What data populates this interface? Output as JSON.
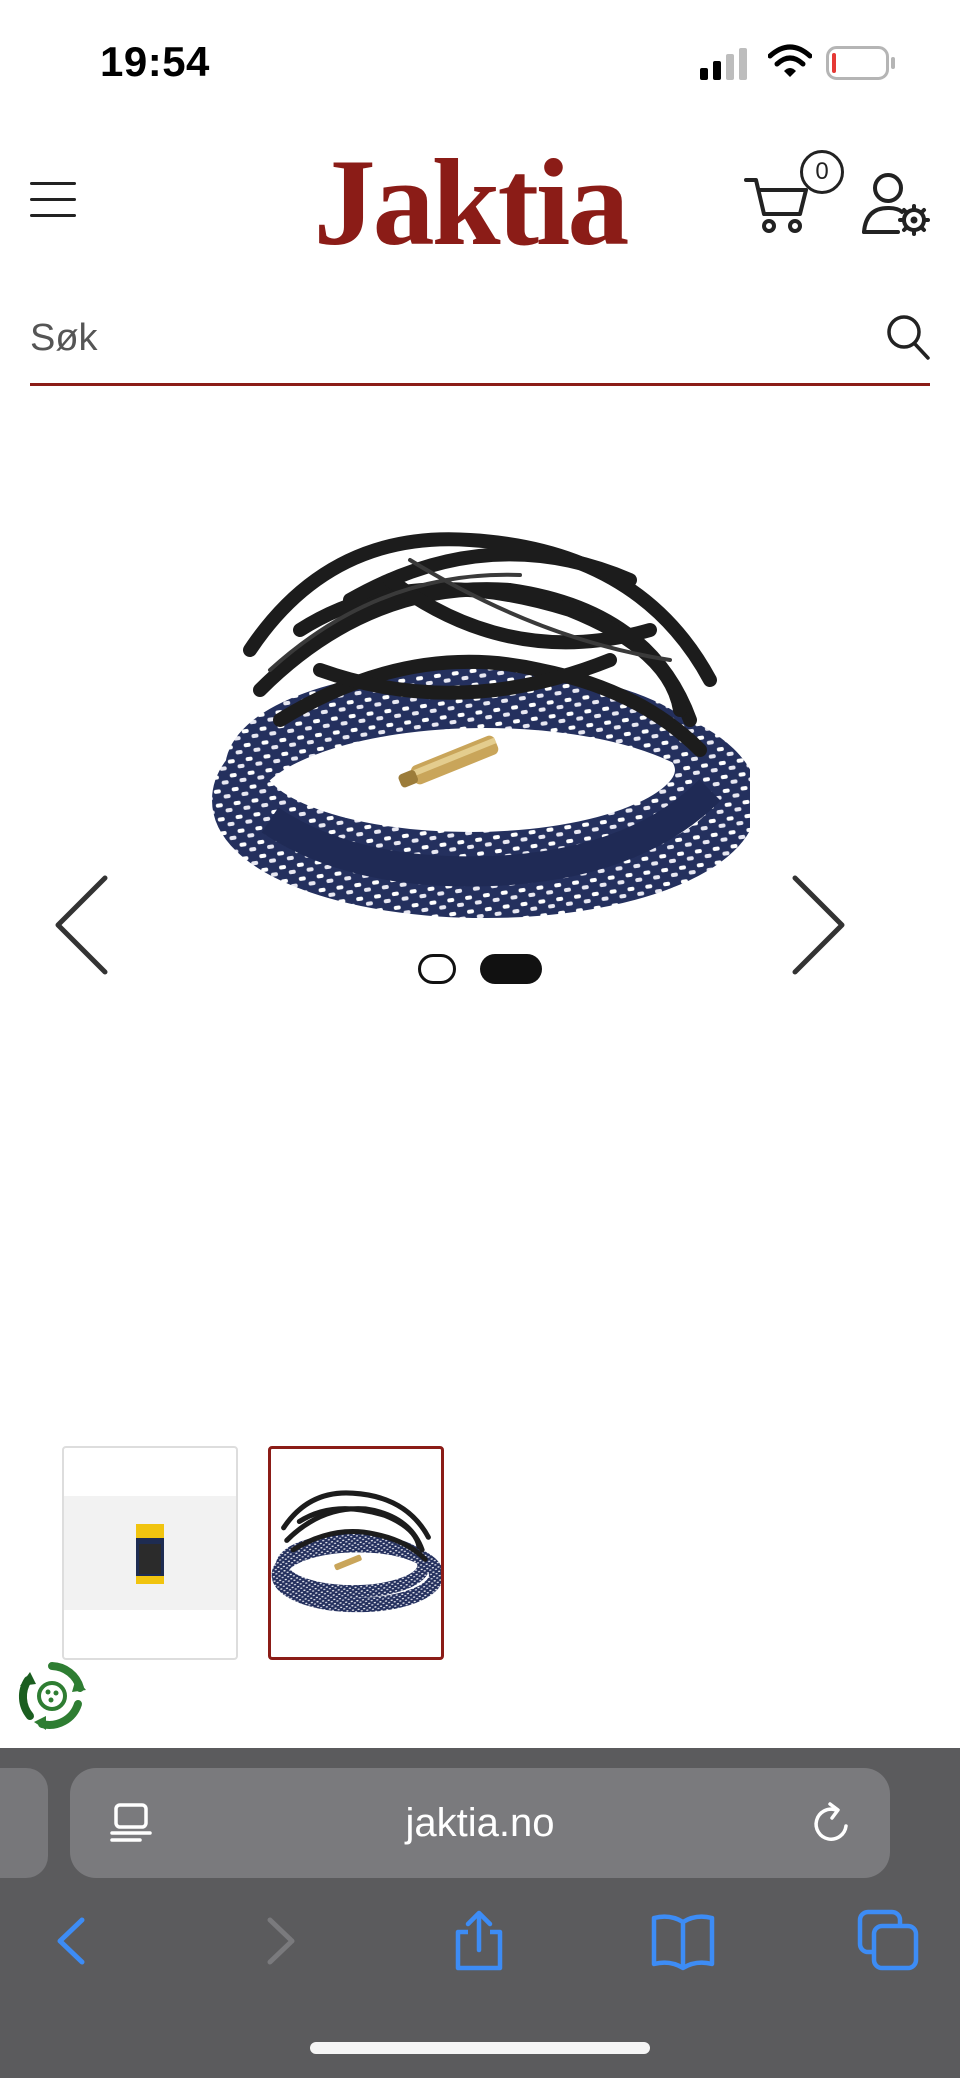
{
  "status_bar": {
    "time": "19:54"
  },
  "header": {
    "logo_text": "Jaktia",
    "cart_count": "0",
    "brand_color": "#8b1c17",
    "icons": [
      "menu-icon",
      "cart-icon",
      "user-settings-icon"
    ]
  },
  "search": {
    "placeholder": "Søk",
    "value": ""
  },
  "gallery": {
    "active_index": 2,
    "image_count": 2,
    "thumbnails": [
      {
        "label": "packaging"
      },
      {
        "label": "bore snake"
      }
    ]
  },
  "browser": {
    "url": "jaktia.no",
    "toolbar": [
      "back-icon",
      "forward-icon",
      "share-icon",
      "bookmarks-icon",
      "tabs-icon"
    ],
    "accent_color": "#3d8cf5"
  }
}
